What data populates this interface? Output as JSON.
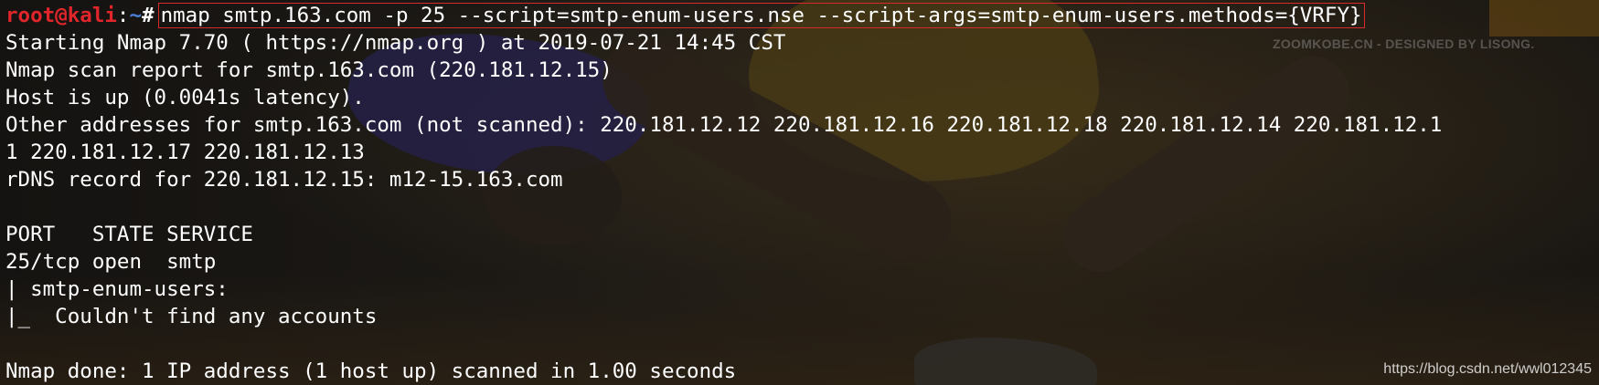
{
  "prompt": {
    "user_host": "root@kali",
    "separator": ":",
    "path": "~",
    "symbol": "#"
  },
  "command": "nmap smtp.163.com -p 25 --script=smtp-enum-users.nse --script-args=smtp-enum-users.methods={VRFY}",
  "output": [
    "Starting Nmap 7.70 ( https://nmap.org ) at 2019-07-21 14:45 CST",
    "Nmap scan report for smtp.163.com (220.181.12.15)",
    "Host is up (0.0041s latency).",
    "Other addresses for smtp.163.com (not scanned): 220.181.12.12 220.181.12.16 220.181.12.18 220.181.12.14 220.181.12.1",
    "1 220.181.12.17 220.181.12.13",
    "rDNS record for 220.181.12.15: m12-15.163.com",
    "",
    "PORT   STATE SERVICE",
    "25/tcp open  smtp",
    "| smtp-enum-users:",
    "|_  Couldn't find any accounts",
    "",
    "Nmap done: 1 IP address (1 host up) scanned in 1.00 seconds"
  ],
  "watermarks": {
    "top": "ZOOMKOBE.CN - DESIGNED BY LISONG.",
    "bottom": "https://blog.csdn.net/wwl012345"
  },
  "colors": {
    "prompt_user": "#e0262a",
    "prompt_path": "#4b7fd8",
    "text": "#ffffff",
    "highlight_box": "#d62b2b"
  }
}
